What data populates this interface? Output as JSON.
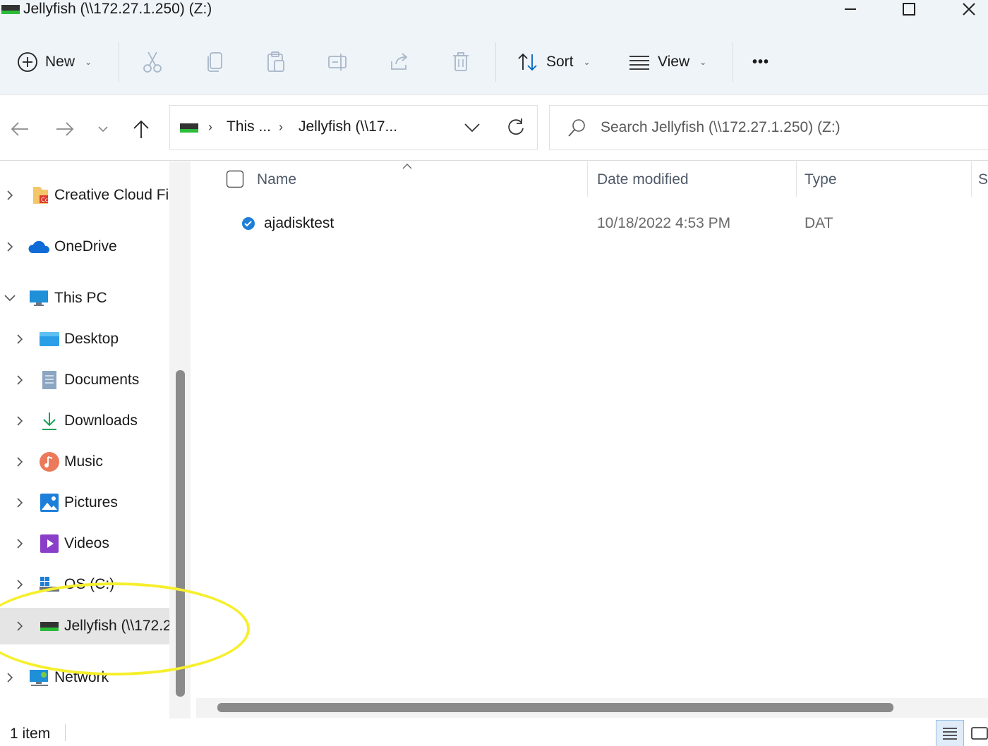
{
  "window": {
    "title": "Jellyfish (\\\\172.27.1.250) (Z:)"
  },
  "toolbar": {
    "new_label": "New",
    "sort_label": "Sort",
    "view_label": "View",
    "more_label": "•••"
  },
  "address": {
    "crumbs": [
      "This ...",
      "Jellyfish (\\\\17..."
    ]
  },
  "search": {
    "placeholder": "Search Jellyfish (\\\\172.27.1.250) (Z:)"
  },
  "nav": {
    "items": [
      {
        "label": "Creative Cloud Fi",
        "icon": "creative-cloud-folder-icon"
      },
      {
        "label": "OneDrive",
        "icon": "onedrive-cloud-icon"
      },
      {
        "label": "This PC",
        "icon": "computer-icon"
      },
      {
        "label": "Desktop",
        "icon": "desktop-icon"
      },
      {
        "label": "Documents",
        "icon": "documents-icon"
      },
      {
        "label": "Downloads",
        "icon": "downloads-icon"
      },
      {
        "label": "Music",
        "icon": "music-icon"
      },
      {
        "label": "Pictures",
        "icon": "pictures-icon"
      },
      {
        "label": "Videos",
        "icon": "videos-icon"
      },
      {
        "label": "OS (C:)",
        "icon": "drive-icon"
      },
      {
        "label": "Jellyfish (\\\\172.2",
        "icon": "network-drive-icon"
      },
      {
        "label": "Network",
        "icon": "network-icon"
      }
    ],
    "selected": "Jellyfish (\\\\172.2"
  },
  "columns": {
    "name": "Name",
    "date_modified": "Date modified",
    "type": "Type",
    "size": "S"
  },
  "files": [
    {
      "name": "ajadisktest",
      "date_modified": "10/18/2022 4:53 PM",
      "type": "DAT"
    }
  ],
  "status": {
    "item_count": "1 item"
  },
  "colors": {
    "toolbar_bg": "#eff4f9",
    "accent": "#0067c0",
    "highlight": "#f6ef2c"
  }
}
